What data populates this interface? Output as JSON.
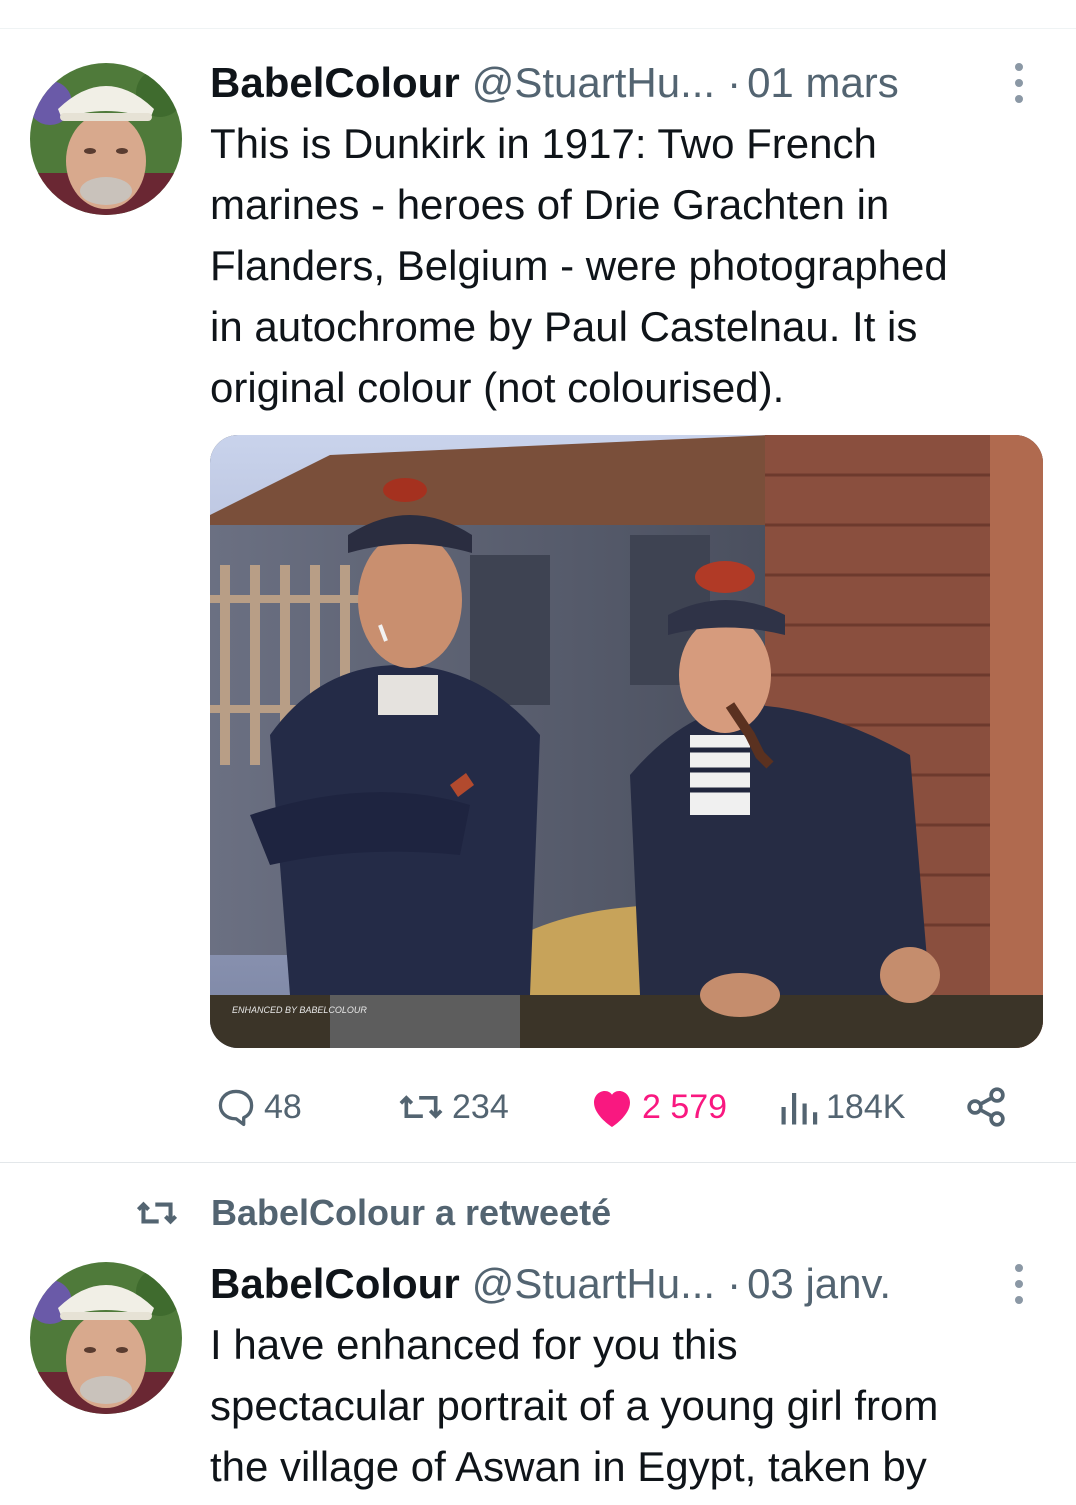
{
  "tweets": [
    {
      "author_name": "BabelColour",
      "author_handle": "@StuartHu...",
      "separator": "·",
      "time": "01 mars",
      "text_lines": [
        "This is Dunkirk in 1917: Two French",
        "marines - heroes of Drie Grachten in",
        "Flanders, Belgium - were photographed",
        "in autochrome by Paul Castelnau. It is",
        "original colour (not colourised)."
      ],
      "media_watermark": "ENHANCED BY BABELCOLOUR",
      "metrics": {
        "replies": "48",
        "retweets": "234",
        "likes": "2 579",
        "views": "184K"
      }
    },
    {
      "retweeted_by_label": "BabelColour a retweeté",
      "author_name": "BabelColour",
      "author_handle": "@StuartHu...",
      "separator": "·",
      "time": "03 janv.",
      "text_lines": [
        "I have enhanced for you this",
        "spectacular portrait of a young girl from",
        "the village of Aswan in Egypt, taken by"
      ]
    }
  ],
  "icons": {
    "reply": "reply-icon",
    "retweet": "retweet-icon",
    "like": "heart-icon",
    "views": "views-icon",
    "share": "share-icon",
    "more": "more-icon"
  },
  "colors": {
    "text_primary": "#0f1419",
    "text_secondary": "#536471",
    "like_active": "#f91880",
    "divider": "#eff3f4"
  }
}
